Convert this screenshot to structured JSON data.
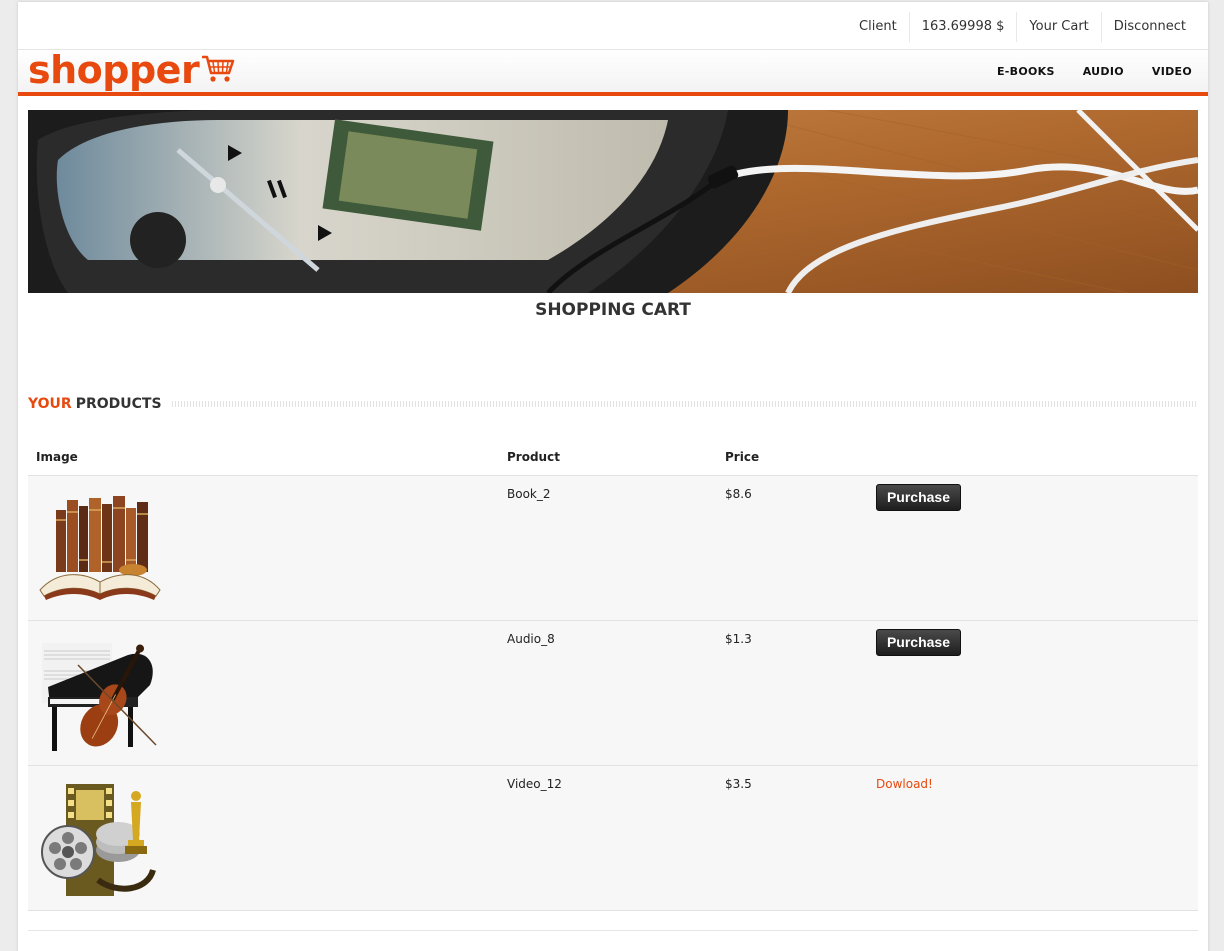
{
  "topbar": {
    "client_label": "Client",
    "balance": "163.69998 $",
    "cart_label": "Your Cart",
    "disconnect_label": "Disconnect"
  },
  "header": {
    "logo_text": "shopper",
    "logo_icon": "shopping-cart-icon",
    "nav": [
      "E-BOOKS",
      "AUDIO",
      "VIDEO"
    ]
  },
  "page": {
    "title": "SHOPPING CART",
    "section_accent": "YOUR",
    "section_rest": "PRODUCTS"
  },
  "table": {
    "headers": {
      "image": "Image",
      "product": "Product",
      "price": "Price"
    },
    "rows": [
      {
        "image": "books-image",
        "product": "Book_2",
        "price": "$8.6",
        "action": "Purchase",
        "action_type": "button"
      },
      {
        "image": "piano-cello-image",
        "product": "Audio_8",
        "price": "$1.3",
        "action": "Purchase",
        "action_type": "button"
      },
      {
        "image": "film-reel-oscar-image",
        "product": "Video_12",
        "price": "$3.5",
        "action": "Dowload!",
        "action_type": "link"
      }
    ]
  },
  "colors": {
    "accent": "#e8490f",
    "row_bg": "#f7f7f7",
    "button_bg": "#2a2a2a"
  }
}
